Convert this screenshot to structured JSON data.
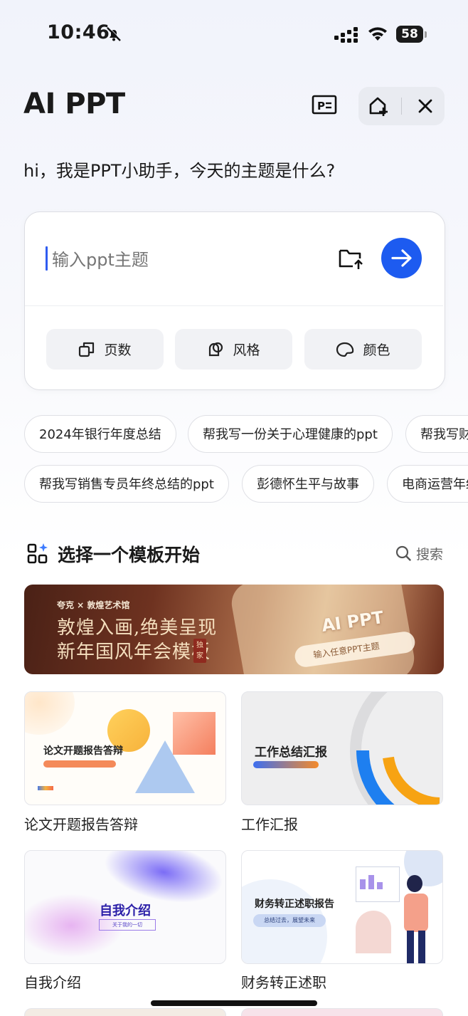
{
  "status": {
    "time": "10:46",
    "battery": "58"
  },
  "header": {
    "title": "AI PPT"
  },
  "greeting": "hi，我是PPT小助手，今天的主题是什么?",
  "input": {
    "placeholder": "输入ppt主题"
  },
  "options": [
    {
      "label": "页数"
    },
    {
      "label": "风格"
    },
    {
      "label": "颜色"
    }
  ],
  "suggestions_row1": [
    "2024年银行年度总结",
    "帮我写一份关于心理健康的ppt",
    "帮我写财"
  ],
  "suggestions_row2": [
    "帮我写销售专员年终总结的ppt",
    "彭德怀生平与故事",
    "电商运营年终"
  ],
  "templates_section": {
    "title": "选择一个模板开始",
    "search_label": "搜索"
  },
  "banner": {
    "brand": "夸克 × 敦煌艺术馆",
    "line1": "敦煌入画,绝美呈现",
    "line2": "新年国风年会模板",
    "tag": "独家",
    "ai_text": "AI PPT",
    "input_text": "输入任意PPT主题"
  },
  "templates": [
    {
      "label": "论文开题报告答辩",
      "thumb_title": "论文开题报告答辩"
    },
    {
      "label": "工作汇报",
      "thumb_title": "工作总结汇报"
    },
    {
      "label": "自我介绍",
      "thumb_title": "自我介绍",
      "thumb_sub": "关于我的一切"
    },
    {
      "label": "财务转正述职",
      "thumb_title": "财务转正述职报告",
      "thumb_sub": "总结过去，展望未来"
    }
  ]
}
